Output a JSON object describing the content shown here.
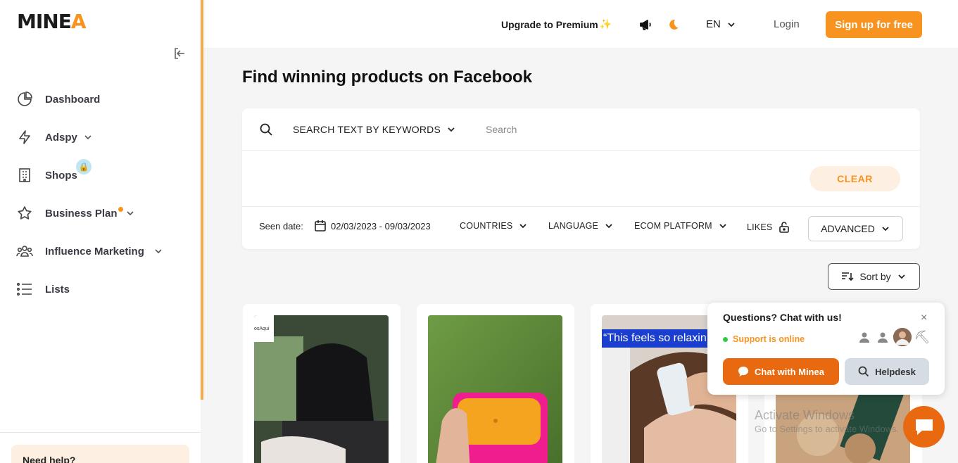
{
  "brand": {
    "name_prefix": "MINE",
    "name_suffix": "A",
    "accent": "#f7931e"
  },
  "sidebar": {
    "items": [
      {
        "label": "Dashboard",
        "icon": "pie-chart-icon"
      },
      {
        "label": "Adspy",
        "icon": "lightning-icon",
        "has_chevron": true
      },
      {
        "label": "Shops",
        "icon": "building-icon",
        "locked": true
      },
      {
        "label": "Business Plan",
        "icon": "star-icon",
        "has_chevron": true,
        "badge_dot": true
      },
      {
        "label": "Influence Marketing",
        "icon": "users-icon",
        "has_chevron": true
      },
      {
        "label": "Lists",
        "icon": "list-icon"
      }
    ],
    "help_text": "Need help?"
  },
  "header": {
    "upgrade_label": "Upgrade to Premium",
    "language": "EN",
    "login_label": "Login",
    "signup_label": "Sign up for free"
  },
  "main": {
    "title": "Find winning products on Facebook",
    "search": {
      "mode_label": "SEARCH TEXT BY KEYWORDS",
      "placeholder": "Search",
      "clear_label": "CLEAR"
    },
    "filters": {
      "seen_label": "Seen date:",
      "date_range": "02/03/2023 - 09/03/2023",
      "countries": "COUNTRIES",
      "language": "LANGUAGE",
      "ecom_platform": "ECOM PLATFORM",
      "likes": "LIKES",
      "advanced": "ADVANCED"
    },
    "sort_label": "Sort by",
    "cards": [
      {
        "thumb_text": "osAqui"
      },
      {
        "thumb_text": ""
      },
      {
        "thumb_text": "“This feels so relaxin"
      },
      {
        "thumb_text": ""
      }
    ]
  },
  "chat": {
    "title": "Questions? Chat with us!",
    "status": "Support is online",
    "chat_button": "Chat with Minea",
    "helpdesk_button": "Helpdesk",
    "close": "×"
  },
  "watermark": {
    "line1": "Activate Windows",
    "line2": "Go to Settings to activate Windows."
  }
}
